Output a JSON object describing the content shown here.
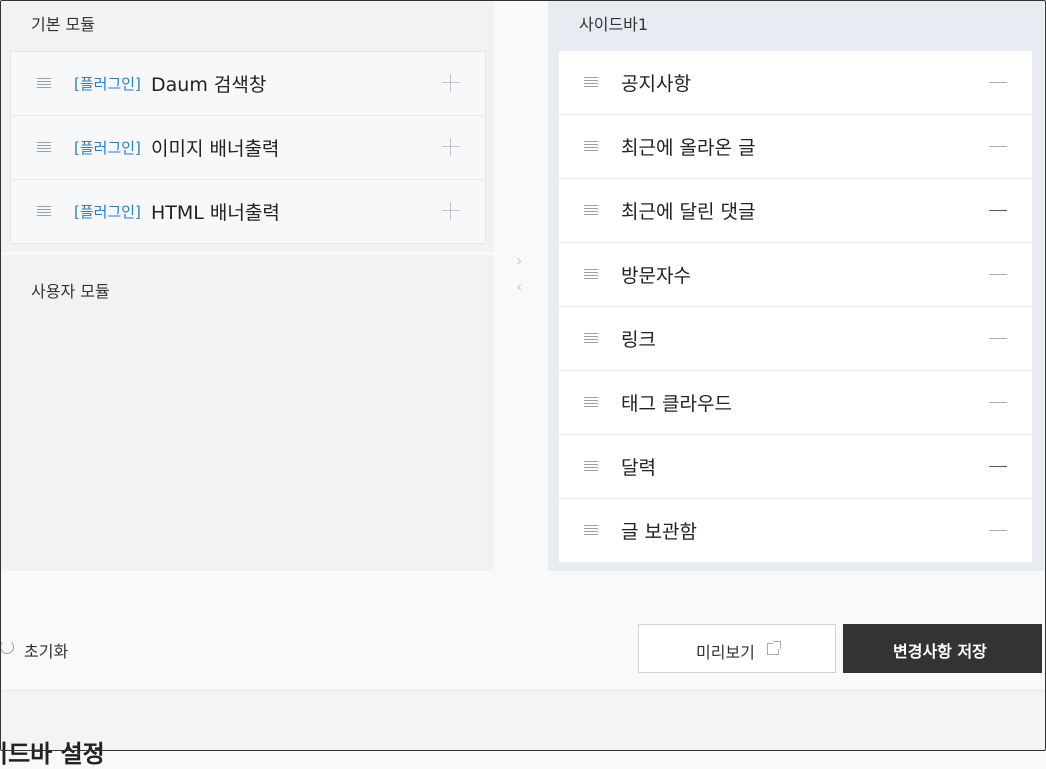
{
  "basic_modules": {
    "title": "기본 모듈",
    "items": [
      {
        "tag": "[플러그인]",
        "name": "Daum 검색창"
      },
      {
        "tag": "[플러그인]",
        "name": "이미지 배너출력"
      },
      {
        "tag": "[플러그인]",
        "name": "HTML 배너출력"
      }
    ]
  },
  "user_modules": {
    "title": "사용자 모듈"
  },
  "sidebar": {
    "title": "사이드바1",
    "items": [
      {
        "name": "공지사항"
      },
      {
        "name": "최근에 올라온 글"
      },
      {
        "name": "최근에 달린 댓글"
      },
      {
        "name": "방문자수"
      },
      {
        "name": "링크"
      },
      {
        "name": "태그 클라우드"
      },
      {
        "name": "달력"
      },
      {
        "name": "글 보관함"
      }
    ]
  },
  "actions": {
    "reset_label": "초기화",
    "preview_label": "미리보기",
    "save_label": "변경사항 저장"
  },
  "section": {
    "heading": "이드바 설정"
  },
  "icons": {
    "handle": "drag-handle-icon",
    "add": "plus-icon",
    "remove": "minus-icon",
    "reset": "refresh-icon",
    "external": "external-link-icon"
  },
  "colors": {
    "accent": "#2a7fc9",
    "primary_button": "#333333"
  }
}
